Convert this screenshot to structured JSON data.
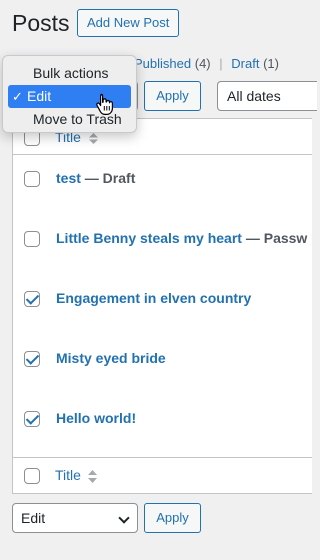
{
  "header": {
    "title": "Posts",
    "add_new_label": "Add New Post"
  },
  "views": {
    "published_label": "Published",
    "published_count": "(4)",
    "separator": "|",
    "draft_label": "Draft",
    "draft_count": "(1)"
  },
  "top_actions": {
    "apply_label": "Apply",
    "dates_value": "All dates"
  },
  "bulk_menu": {
    "items": [
      "Bulk actions",
      "Edit",
      "Move to Trash"
    ],
    "selected_check": "✓"
  },
  "table": {
    "column_title": "Title",
    "rows": [
      {
        "title": "test",
        "state": " — Draft",
        "checked": false
      },
      {
        "title": "Little Benny steals my heart",
        "state": " — Passw",
        "checked": false
      },
      {
        "title": "Engagement in elven country",
        "state": "",
        "checked": true
      },
      {
        "title": "Misty eyed bride",
        "state": "",
        "checked": true
      },
      {
        "title": "Hello world!",
        "state": "",
        "checked": true
      }
    ]
  },
  "bottom_actions": {
    "select_value": "Edit",
    "apply_label": "Apply"
  },
  "colors": {
    "link": "#2271b1",
    "menu_selected": "#2f7ff2",
    "page_bg": "#f0f0f1"
  }
}
